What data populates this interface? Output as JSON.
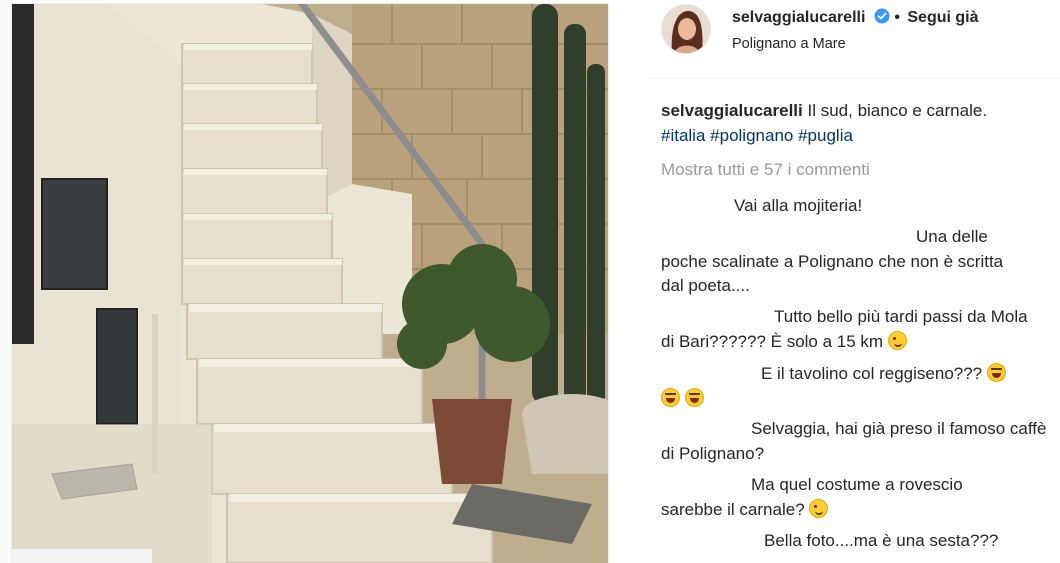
{
  "photo": {
    "alt": "Scalinata bianca a Polignano a Mare"
  },
  "header": {
    "username": "selvaggialucarelli",
    "verified_icon": "verified-badge-icon",
    "separator": "•",
    "follow_label": "Segui già",
    "location": "Polignano a Mare"
  },
  "caption": {
    "username": "selvaggialucarelli",
    "text": "Il sud, bianco e carnale.",
    "hashtags": [
      "#italia",
      "#polignano",
      "#puglia"
    ]
  },
  "comments_link": "Mostra tutti e 57 i commenti",
  "comments": [
    {
      "text": "Vai alla mojiteria!"
    },
    {
      "text": "Una delle poche scalinate a Polignano che non è scritta dal poeta...."
    },
    {
      "text": "Tutto bello più tardi passi da Mola di Bari?????? È solo a 15 km",
      "emoji": "wink-emoji-icon"
    },
    {
      "text": "E il tavolino col reggiseno???",
      "emoji": "laughing-emoji-icon"
    },
    {
      "text": "Selvaggia, hai già preso il famoso caffè di Polignano?"
    },
    {
      "text": "Ma quel costume a rovescio sarebbe il carnale?",
      "emoji": "wink-emoji-icon"
    },
    {
      "text": "Bella foto....ma è una sesta???"
    }
  ],
  "colors": {
    "text": "#262626",
    "muted": "#999999",
    "hashtag": "#003569",
    "verified": "#3897f0"
  }
}
